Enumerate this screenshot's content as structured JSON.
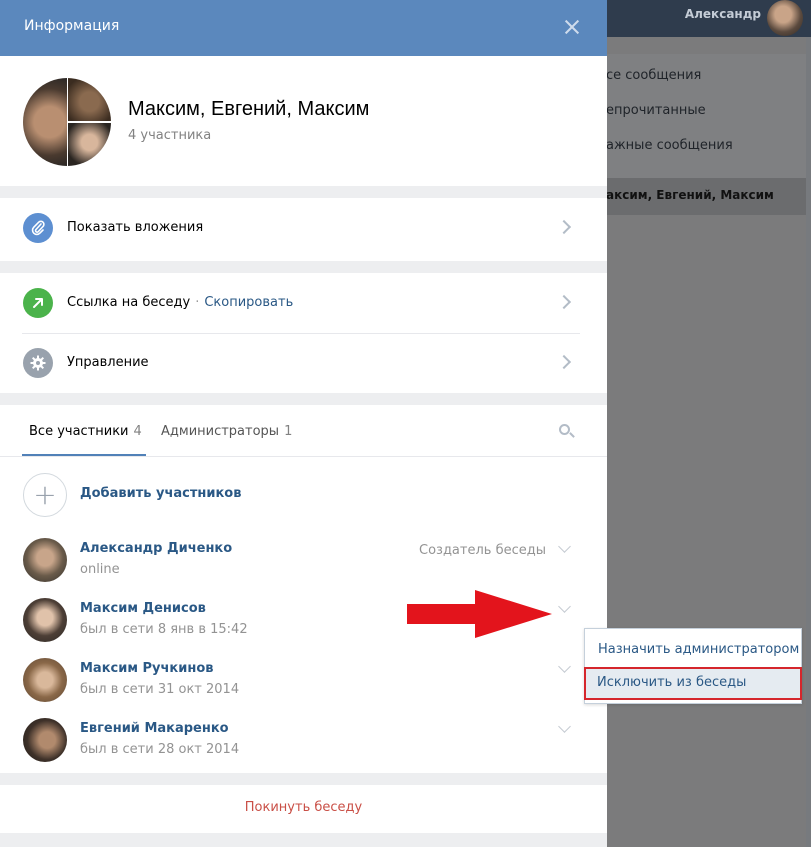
{
  "background": {
    "user_name": "Александр",
    "menu": [
      "се сообщения",
      "епрочитанные",
      "ажные сообщения"
    ],
    "current_conversation": "аксим, Евгений, Максим"
  },
  "modal": {
    "title": "Информация",
    "chat_title": "Максим, Евгений, Максим",
    "chat_members": "4 участника",
    "attachments_label": "Показать вложения",
    "link_label": "Ссылка на беседу",
    "link_separator": "·",
    "copy_label": "Скопировать",
    "manage_label": "Управление",
    "tabs": [
      {
        "label": "Все участники",
        "count": "4"
      },
      {
        "label": "Администраторы",
        "count": "1"
      }
    ],
    "add_members_label": "Добавить участников",
    "members": [
      {
        "name": "Александр Диченко",
        "status": "online",
        "role": "Создатель беседы"
      },
      {
        "name": "Максим Денисов",
        "status": "был в сети 8 янв в 15:42",
        "role": ""
      },
      {
        "name": "Максим Ручкинов",
        "status": "был в сети 31 окт 2014",
        "role": ""
      },
      {
        "name": "Евгений Макаренко",
        "status": "был в сети 28 окт 2014",
        "role": ""
      }
    ],
    "leave_label": "Покинуть беседу"
  },
  "dropdown": {
    "items": [
      "Назначить администратором",
      "Исключить из беседы"
    ]
  },
  "colors": {
    "header_blue": "#5b88bd",
    "link_blue": "#2a5885",
    "leave_red": "#c94f46",
    "annotation_red": "#d5262c"
  }
}
